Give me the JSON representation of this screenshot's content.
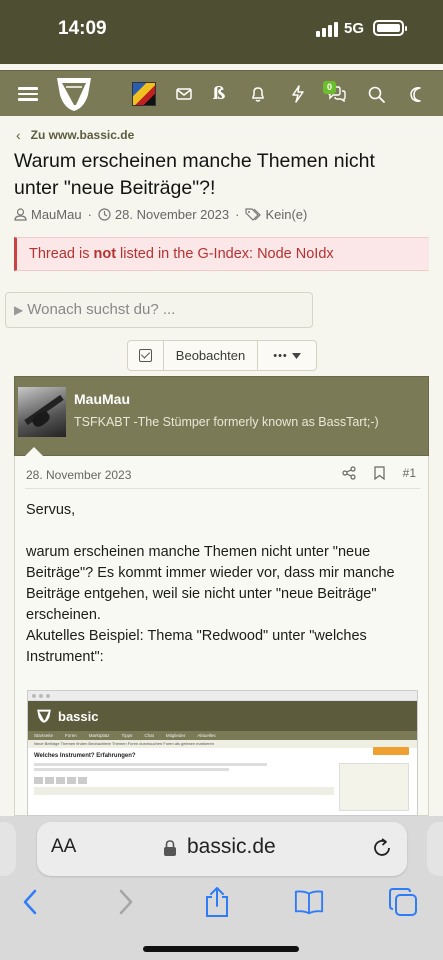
{
  "status_bar": {
    "time": "14:09",
    "network": "5G"
  },
  "nav": {
    "icons": [
      "menu-icon",
      "logo-icon",
      "avatar",
      "mail-icon",
      "beta-icon",
      "bell-icon",
      "bolt-icon",
      "chat-icon",
      "search-icon",
      "moon-icon"
    ],
    "beta_label": "ß",
    "chat_badge": "0",
    "accent": "#7a7a56"
  },
  "breadcrumb": {
    "link": "Zu www.bassic.de"
  },
  "thread": {
    "title": "Warum erscheinen manche Themen nicht unter \"neue Beiträge\"?!",
    "author": "MauMau",
    "date": "28. November 2023",
    "tags": "Kein(e)"
  },
  "alert": {
    "prefix": "Thread is ",
    "emphasis": "not",
    "suffix": " listed in the G-Index: Node NoIdx"
  },
  "search": {
    "placeholder": "Wonach suchst du? ..."
  },
  "actions": {
    "watch_label": "Beobachten",
    "more_label": "•••"
  },
  "post": {
    "username": "MauMau",
    "user_title": "TSFKABT -The Stümper formerly known as BassTart;-)",
    "date": "28. November 2023",
    "number": "#1",
    "greeting": "Servus,",
    "paragraph1": "warum erscheinen manche Themen nicht unter \"neue Beiträge\"? Es kommt immer wieder vor, dass mir manche Beiträge entgehen, weil sie nicht unter \"neue Beiträge\" erscheinen.",
    "paragraph2": "Akutelles Beispiel: Thema \"Redwood\" unter \"welches Instrument\":",
    "embed": {
      "brand": "bassic",
      "tabs": [
        "Startseite",
        "Foren",
        "Marktplatz",
        "Tipps",
        "Chat",
        "Mitglieder",
        "Aktuelles"
      ],
      "subnav": "Neue Beiträge  Themen finden  Beobachtete Themen  Foren durchsuchen  Foren als gelesen markieren",
      "title": "Welches Instrument? Erfahrungen?"
    }
  },
  "safari": {
    "text_size": "AA",
    "url": "bassic.de"
  }
}
